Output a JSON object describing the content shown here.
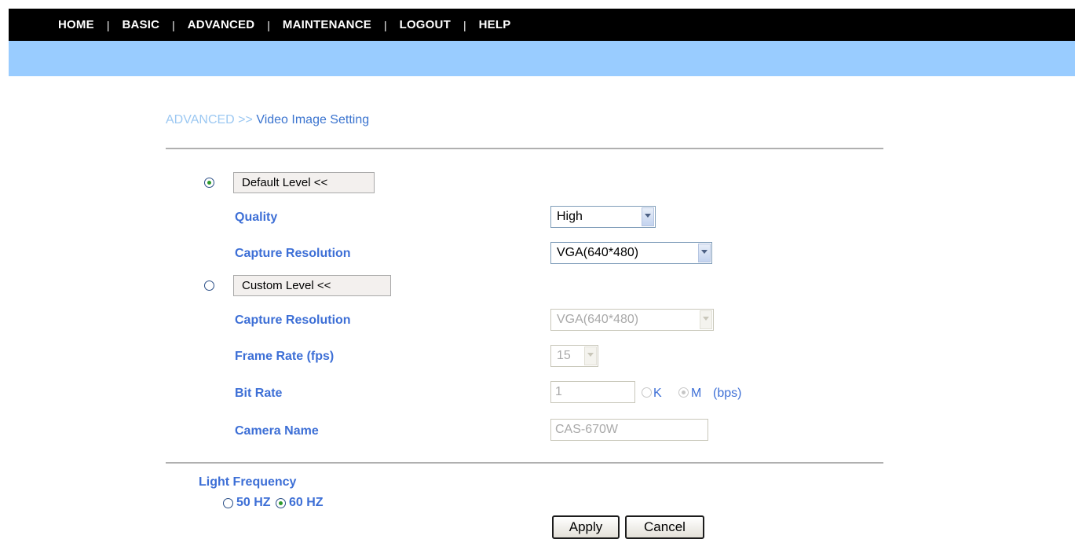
{
  "nav": {
    "items": [
      "HOME",
      "BASIC",
      "ADVANCED",
      "MAINTENANCE",
      "LOGOUT",
      "HELP"
    ],
    "separator": "|"
  },
  "breadcrumb": {
    "section": "ADVANCED >>",
    "page": "Video Image Setting"
  },
  "default_level": {
    "selected": true,
    "button_label": "Default Level <<",
    "quality_label": "Quality",
    "quality_value": "High",
    "resolution_label": "Capture Resolution",
    "resolution_value": "VGA(640*480)"
  },
  "custom_level": {
    "selected": false,
    "button_label": "Custom Level <<",
    "resolution_label": "Capture Resolution",
    "resolution_value": "VGA(640*480)",
    "frame_rate_label": "Frame Rate (fps)",
    "frame_rate_value": "15",
    "bit_rate_label": "Bit Rate",
    "bit_rate_value": "1",
    "bit_rate_unit_k": "K",
    "bit_rate_unit_m": "M",
    "bit_rate_unit_selected": "M",
    "bit_rate_suffix": "(bps)",
    "camera_name_label": "Camera Name",
    "camera_name_value": "CAS-670W"
  },
  "light_frequency": {
    "label": "Light Frequency",
    "option_50": "50 HZ",
    "option_60": "60 HZ",
    "selected": "60 HZ"
  },
  "buttons": {
    "apply": "Apply",
    "cancel": "Cancel"
  },
  "colors": {
    "nav_bg": "#000000",
    "band_bg": "#99ccff",
    "label": "#3d6fd6",
    "breadcrumb_section": "#9cc8f2",
    "breadcrumb_page": "#3b74cf"
  }
}
